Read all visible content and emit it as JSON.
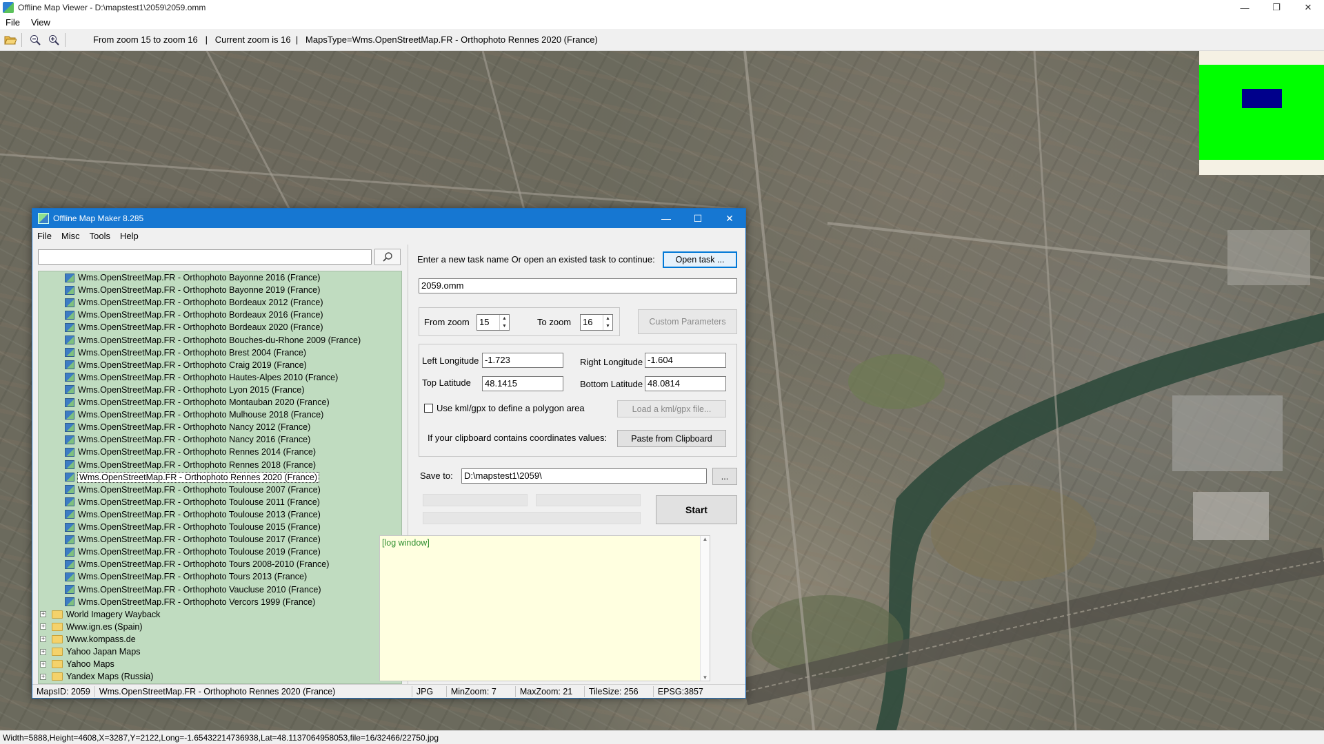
{
  "viewer": {
    "title": "Offline Map Viewer - D:\\mapstest1\\2059\\2059.omm",
    "menu": [
      "File",
      "View"
    ],
    "toolbar_info": "From zoom 15 to zoom 16   |   Current zoom is 16  |   MapsType=Wms.OpenStreetMap.FR - Orthophoto Rennes 2020 (France)",
    "status": "Width=5888,Height=4608,X=3287,Y=2122,Long=-1.65432214736938,Lat=48.1137064958053,file=16/32466/22750.jpg",
    "icons": [
      "folder-open-icon",
      "zoom-out-icon",
      "zoom-in-icon"
    ],
    "minimap_colors": {
      "background": "#00ff00",
      "viewport": "#00008b"
    }
  },
  "maker": {
    "title": "Offline Map Maker 8.285",
    "menu": [
      "File",
      "Misc",
      "Tools",
      "Help"
    ],
    "search_value": "",
    "tree_items": [
      "Wms.OpenStreetMap.FR - Orthophoto Bayonne 2016 (France)",
      "Wms.OpenStreetMap.FR - Orthophoto Bayonne 2019 (France)",
      "Wms.OpenStreetMap.FR - Orthophoto Bordeaux 2012 (France)",
      "Wms.OpenStreetMap.FR - Orthophoto Bordeaux 2016 (France)",
      "Wms.OpenStreetMap.FR - Orthophoto Bordeaux 2020 (France)",
      "Wms.OpenStreetMap.FR - Orthophoto Bouches-du-Rhone 2009 (France)",
      "Wms.OpenStreetMap.FR - Orthophoto Brest 2004 (France)",
      "Wms.OpenStreetMap.FR - Orthophoto Craig 2019 (France)",
      "Wms.OpenStreetMap.FR - Orthophoto Hautes-Alpes 2010 (France)",
      "Wms.OpenStreetMap.FR - Orthophoto Lyon 2015 (France)",
      "Wms.OpenStreetMap.FR - Orthophoto Montauban 2020 (France)",
      "Wms.OpenStreetMap.FR - Orthophoto Mulhouse 2018 (France)",
      "Wms.OpenStreetMap.FR - Orthophoto Nancy 2012 (France)",
      "Wms.OpenStreetMap.FR - Orthophoto Nancy 2016 (France)",
      "Wms.OpenStreetMap.FR - Orthophoto Rennes 2014 (France)",
      "Wms.OpenStreetMap.FR - Orthophoto Rennes 2018 (France)",
      "Wms.OpenStreetMap.FR - Orthophoto Rennes 2020 (France)",
      "Wms.OpenStreetMap.FR - Orthophoto Toulouse 2007 (France)",
      "Wms.OpenStreetMap.FR - Orthophoto Toulouse 2011 (France)",
      "Wms.OpenStreetMap.FR - Orthophoto Toulouse 2013 (France)",
      "Wms.OpenStreetMap.FR - Orthophoto Toulouse 2015 (France)",
      "Wms.OpenStreetMap.FR - Orthophoto Toulouse 2017 (France)",
      "Wms.OpenStreetMap.FR - Orthophoto Toulouse 2019 (France)",
      "Wms.OpenStreetMap.FR - Orthophoto Tours 2008-2010 (France)",
      "Wms.OpenStreetMap.FR - Orthophoto Tours 2013 (France)",
      "Wms.OpenStreetMap.FR - Orthophoto Vaucluse 2010 (France)",
      "Wms.OpenStreetMap.FR - Orthophoto Vercors 1999 (France)"
    ],
    "selected_index": 16,
    "tree_folders": [
      "World Imagery Wayback",
      "Www.ign.es (Spain)",
      "Www.kompass.de",
      "Yahoo Japan Maps",
      "Yahoo Maps",
      "Yandex Maps (Russia)"
    ],
    "task_prompt": "Enter a new task name Or open an existed task to continue:",
    "open_task_label": "Open task ...",
    "task_name": "2059.omm",
    "from_zoom_label": "From zoom",
    "from_zoom": "15",
    "to_zoom_label": "To zoom",
    "to_zoom": "16",
    "custom_params_label": "Custom Parameters",
    "left_lon_label": "Left Longitude",
    "left_lon": "-1.723",
    "right_lon_label": "Right Longitude",
    "right_lon": "-1.604",
    "top_lat_label": "Top Latitude",
    "top_lat": "48.1415",
    "bottom_lat_label": "Bottom Latitude",
    "bottom_lat": "48.0814",
    "kml_checkbox_label": "Use kml/gpx to define a polygon area",
    "load_kml_label": "Load a kml/gpx file...",
    "clipboard_prompt": "If your clipboard contains coordinates values:",
    "paste_label": "Paste from Clipboard",
    "save_to_label": "Save to:",
    "save_to": "D:\\mapstest1\\2059\\",
    "browse_label": "...",
    "start_label": "Start",
    "log_text": "[log window]",
    "status": {
      "maps_id": "MapsID: 2059",
      "maps_name": "Wms.OpenStreetMap.FR - Orthophoto Rennes 2020 (France)",
      "format": "JPG",
      "min_zoom": "MinZoom: 7",
      "max_zoom": "MaxZoom: 21",
      "tile_size": "TileSize: 256",
      "epsg": "EPSG:3857"
    }
  }
}
